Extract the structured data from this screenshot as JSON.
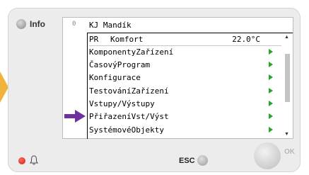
{
  "panel": {
    "info_label": "Info",
    "esc_label": "ESC",
    "ok_label": "OK"
  },
  "screen": {
    "line_number": "0",
    "title": "KJ Mandík",
    "status_row": {
      "code": "PR",
      "mode": "Komfort",
      "temperature": "22.0°C"
    },
    "menu_items": [
      {
        "label": "KomponentyZařízení"
      },
      {
        "label": "ČasovýProgram"
      },
      {
        "label": "Konfigurace"
      },
      {
        "label": "TestováníZařízení"
      },
      {
        "label": "Vstupy/Výstupy"
      },
      {
        "label": "PřiřazeníVst/Výst"
      },
      {
        "label": "SystémovéObjekty"
      }
    ],
    "selected_index": 5
  },
  "colors": {
    "item_arrow": "#28a428",
    "selection_arrow": "#7030a0",
    "side_arrow": "#f0b33c",
    "led_alarm": "#d11d10"
  },
  "icons": [
    "bell-icon",
    "chevron-right-icon",
    "scroll-up-icon",
    "scroll-down-icon",
    "selection-arrow-icon"
  ]
}
